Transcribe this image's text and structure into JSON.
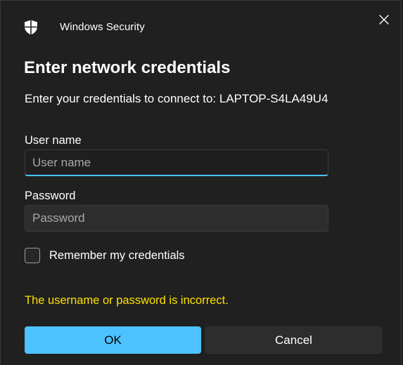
{
  "window": {
    "app_title": "Windows Security",
    "close_icon": "close-icon",
    "shield_icon": "shield-icon"
  },
  "dialog": {
    "heading": "Enter network credentials",
    "subheading": "Enter your credentials to connect to: LAPTOP-S4LA49U4"
  },
  "username": {
    "label": "User name",
    "value": "",
    "placeholder": "User name"
  },
  "password": {
    "label": "Password",
    "value": "",
    "placeholder": "Password"
  },
  "remember": {
    "label": "Remember my credentials",
    "checked": false
  },
  "error": {
    "message": "The username or password is incorrect."
  },
  "buttons": {
    "ok_label": "OK",
    "cancel_label": "Cancel"
  },
  "colors": {
    "accent": "#4cc2ff",
    "error": "#fce100",
    "background": "#202020"
  }
}
